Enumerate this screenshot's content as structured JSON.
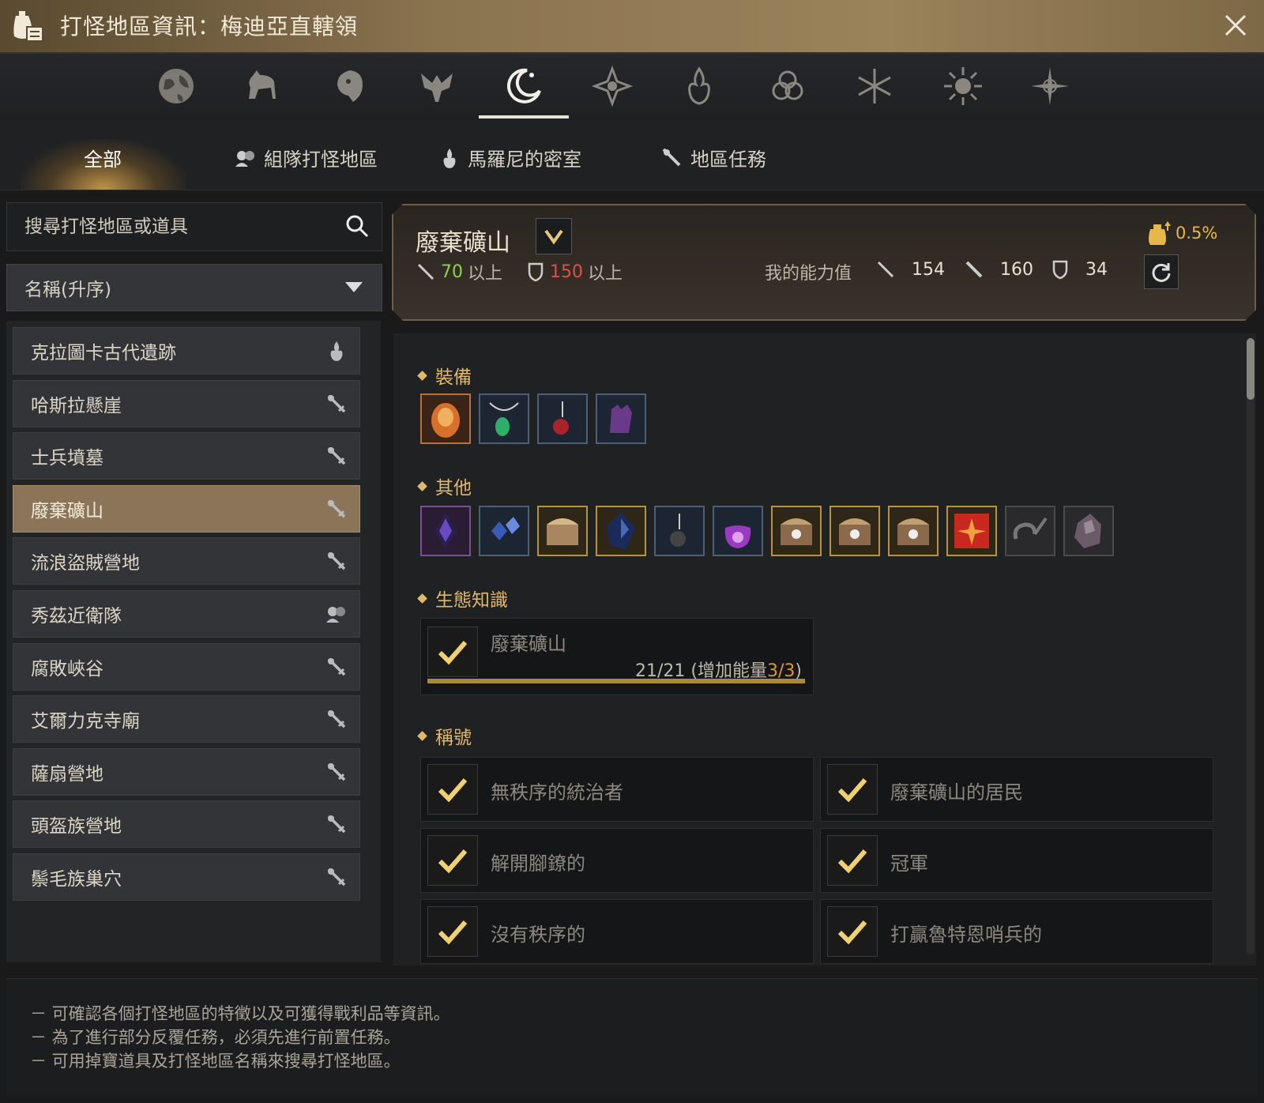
{
  "window": {
    "title": "打怪地區資訊：梅迪亞直轄領"
  },
  "category_icons": [
    {
      "name": "globe-icon"
    },
    {
      "name": "horse-icon"
    },
    {
      "name": "lion-icon"
    },
    {
      "name": "wing-crest-icon"
    },
    {
      "name": "crescent-moon-icon",
      "active": true
    },
    {
      "name": "star-emblem-icon"
    },
    {
      "name": "flame-crest-icon"
    },
    {
      "name": "triquetra-icon"
    },
    {
      "name": "snowflake-icon"
    },
    {
      "name": "sunburst-icon"
    },
    {
      "name": "compass-star-icon"
    }
  ],
  "subtabs": {
    "all": "全部",
    "party": "組隊打怪地區",
    "maruni": "馬羅尼的密室",
    "quests": "地區任務"
  },
  "search": {
    "placeholder": "搜尋打怪地區或道具"
  },
  "sort": {
    "selected": "名稱(升序)"
  },
  "zone_list": [
    {
      "label": "克拉圖卡古代遺跡",
      "icon": "maruni-icon"
    },
    {
      "label": "哈斯拉懸崖",
      "icon": "quest-icon"
    },
    {
      "label": "士兵墳墓",
      "icon": "quest-icon"
    },
    {
      "label": "廢棄礦山",
      "icon": "quest-icon",
      "selected": true
    },
    {
      "label": "流浪盜賊營地",
      "icon": "quest-icon"
    },
    {
      "label": "秀茲近衛隊",
      "icon": "party-icon"
    },
    {
      "label": "腐敗峽谷",
      "icon": "quest-icon"
    },
    {
      "label": "艾爾力克寺廟",
      "icon": "quest-icon"
    },
    {
      "label": "薩扇營地",
      "icon": "quest-icon"
    },
    {
      "label": "頭盔族營地",
      "icon": "quest-icon"
    },
    {
      "label": "鬃毛族巢穴",
      "icon": "quest-icon"
    }
  ],
  "zone": {
    "name": "廢棄礦山",
    "req_ap": "70",
    "req_ap_suffix": "以上",
    "req_dp": "150",
    "req_dp_suffix": "以上",
    "my_stats_label": "我的能力值",
    "my_ap": "154",
    "my_aap": "160",
    "my_dp": "34",
    "bonus": "0.5%"
  },
  "sections": {
    "equipment": "裝備",
    "others": "其他",
    "knowledge": "生態知識",
    "titles": "稱號"
  },
  "equipment_items": [
    {
      "name": "orange-armor-item",
      "tier": "orange"
    },
    {
      "name": "green-necklace-item",
      "tier": "blue"
    },
    {
      "name": "red-earring-item",
      "tier": "blue"
    },
    {
      "name": "purple-glove-item",
      "tier": "blue"
    }
  ],
  "other_items": [
    {
      "name": "purple-crystal-item",
      "tier": "purple"
    },
    {
      "name": "blue-crystals-item",
      "tier": "blue"
    },
    {
      "name": "treasure-chest-item",
      "tier": "gold"
    },
    {
      "name": "black-stone-item",
      "tier": "gold"
    },
    {
      "name": "dark-earring-item",
      "tier": "blue"
    },
    {
      "name": "purple-pouch-item",
      "tier": "blue"
    },
    {
      "name": "box-item-1",
      "tier": "gold"
    },
    {
      "name": "box-item-2",
      "tier": "gold"
    },
    {
      "name": "box-item-3",
      "tier": "gold"
    },
    {
      "name": "red-book-item",
      "tier": "gold"
    },
    {
      "name": "dark-hook-item",
      "tier": "gray"
    },
    {
      "name": "ore-item",
      "tier": "gray"
    }
  ],
  "knowledge": {
    "name": "廢棄礦山",
    "progress_prefix": "21/21 (增加能量",
    "progress_accent": "3/3",
    "progress_suffix": ")"
  },
  "titles": [
    "無秩序的統治者",
    "廢棄礦山的居民",
    "解開腳鐐的",
    "冠軍",
    "沒有秩序的",
    "打贏魯特恩哨兵的"
  ],
  "footer": {
    "lines": [
      "－ 可確認各個打怪地區的特徵以及可獲得戰利品等資訊。",
      "－ 為了進行部分反覆任務，必須先進行前置任務。",
      "－ 可用掉寶道具及打怪地區名稱來搜尋打怪地區。"
    ]
  },
  "colors": {
    "accent_gold": "#e1b76a",
    "selected_row": "#8b7457",
    "req_ap": "#8fd24a",
    "req_dp": "#e0504a"
  }
}
